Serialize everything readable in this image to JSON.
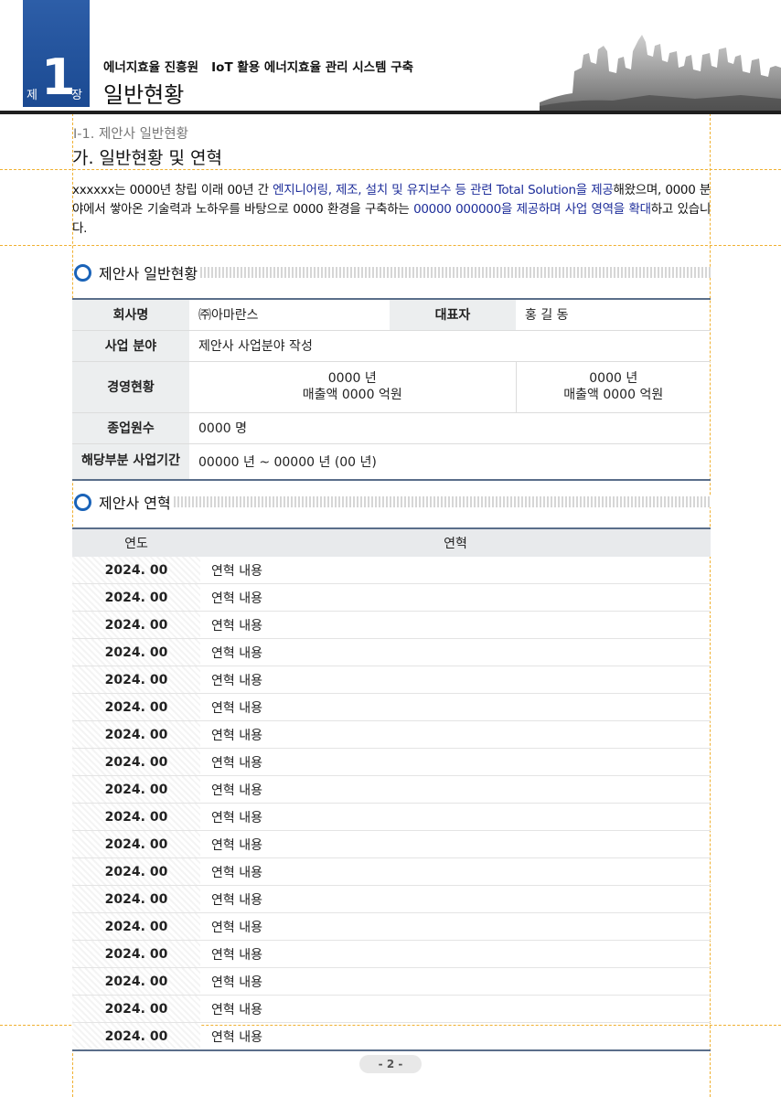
{
  "header": {
    "chapter_prefix": "제",
    "chapter_number": "1",
    "chapter_suffix": "장",
    "subtitle": "에너지효율 진흥원   IoT 활용 에너지효율 관리 시스템 구축",
    "title": "일반현황"
  },
  "section": {
    "small_heading": "Ⅰ-1. 제안사 일반현황",
    "heading": "가. 일반현황 및 연혁",
    "intro": [
      {
        "text": "xxxxxx는 0000년 창립 이래 00년 간 ",
        "hl": false
      },
      {
        "text": "엔지니어링, 제조, 설치 및 유지보수 등 관련 Total Solution을 제공",
        "hl": true
      },
      {
        "text": "해왔으며, 0000 분야에서 쌓아온 기술력과 노하우를 바탕으로 0000 환경을 구축하는 ",
        "hl": false
      },
      {
        "text": "00000 000000을 제공하며 사업 영역을 확대",
        "hl": true
      },
      {
        "text": "하고 있습니다.",
        "hl": false
      }
    ]
  },
  "general": {
    "heading": "제안사 일반현황",
    "company_label": "회사명",
    "company_value": "㈜아마란스",
    "ceo_label": "대표자",
    "ceo_value": "홍 길 동",
    "business_label": "사업 분야",
    "business_value": "제안사 사업분야 작성",
    "mgmt_label": "경영현황",
    "mgmt_year1": "0000 년",
    "mgmt_sales1": "매출액 0000 억원",
    "mgmt_year2": "0000 년",
    "mgmt_sales2": "매출액 0000 억원",
    "employees_label": "종업원수",
    "employees_value": "0000 명",
    "period_label": "해당부분 사업기간",
    "period_value": "00000 년 ~ 00000 년 (00 년)"
  },
  "history": {
    "heading": "제안사 연혁",
    "col_year": "연도",
    "col_content": "연혁",
    "rows": [
      {
        "year": "2024. 00",
        "content": "연혁 내용"
      },
      {
        "year": "2024. 00",
        "content": "연혁 내용"
      },
      {
        "year": "2024. 00",
        "content": "연혁 내용"
      },
      {
        "year": "2024. 00",
        "content": "연혁 내용"
      },
      {
        "year": "2024. 00",
        "content": "연혁 내용"
      },
      {
        "year": "2024. 00",
        "content": "연혁 내용"
      },
      {
        "year": "2024. 00",
        "content": "연혁 내용"
      },
      {
        "year": "2024. 00",
        "content": "연혁 내용"
      },
      {
        "year": "2024. 00",
        "content": "연혁 내용"
      },
      {
        "year": "2024. 00",
        "content": "연혁 내용"
      },
      {
        "year": "2024. 00",
        "content": "연혁 내용"
      },
      {
        "year": "2024. 00",
        "content": "연혁 내용"
      },
      {
        "year": "2024. 00",
        "content": "연혁 내용"
      },
      {
        "year": "2024. 00",
        "content": "연혁 내용"
      },
      {
        "year": "2024. 00",
        "content": "연혁 내용"
      },
      {
        "year": "2024. 00",
        "content": "연혁 내용"
      },
      {
        "year": "2024. 00",
        "content": "연혁 내용"
      },
      {
        "year": "2024. 00",
        "content": "연혁 내용"
      }
    ]
  },
  "footer": {
    "page": "- 2 -"
  }
}
